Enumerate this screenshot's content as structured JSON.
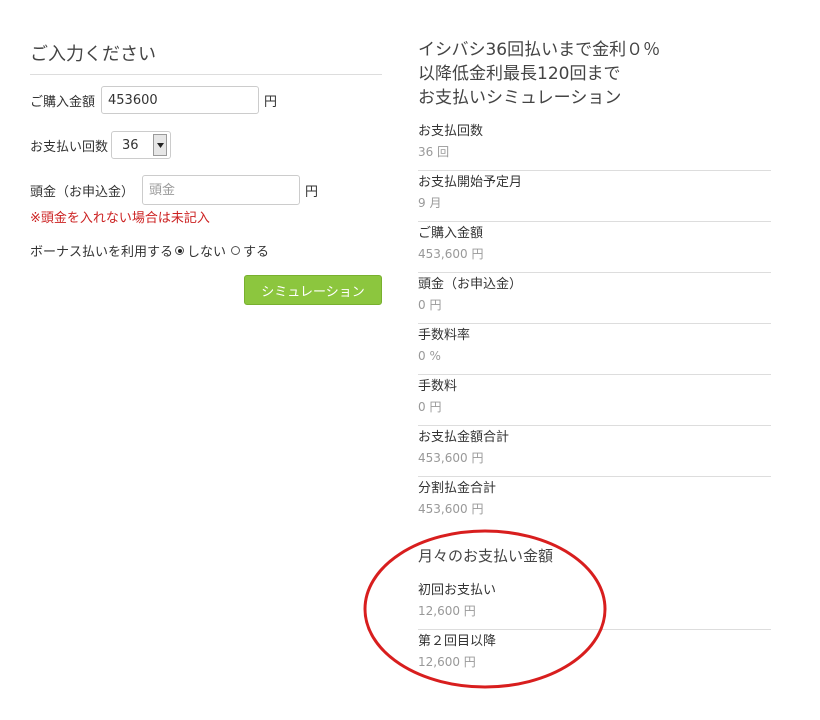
{
  "form": {
    "title": "ご入力ください",
    "amount_label": "ご購入金額",
    "amount_value": "453600",
    "yen": "円",
    "count_label": "お支払い回数",
    "count_value": "36",
    "down_label": "頭金（お申込金）",
    "down_placeholder": "頭金",
    "down_note": "※頭金を入れない場合は未記入",
    "bonus_label": "ボーナス払いを利用する",
    "bonus_no": "しない",
    "bonus_yes": "する",
    "bonus_selected": "しない",
    "button_label": "シミュレーション"
  },
  "result": {
    "title_lines": [
      "イシバシ36回払いまで金利０％",
      "以降低金利最長120回まで",
      "お支払いシミュレーション"
    ],
    "items": [
      {
        "label": "お支払回数",
        "value": "36 回"
      },
      {
        "label": "お支払開始予定月",
        "value": "9 月"
      },
      {
        "label": "ご購入金額",
        "value": "453,600 円"
      },
      {
        "label": "頭金（お申込金）",
        "value": "0 円"
      },
      {
        "label": "手数料率",
        "value": "0 %"
      },
      {
        "label": "手数料",
        "value": "0 円"
      },
      {
        "label": "お支払金額合計",
        "value": "453,600 円"
      },
      {
        "label": "分割払金合計",
        "value": "453,600 円"
      }
    ],
    "monthly_title": "月々のお支払い金額",
    "monthly": [
      {
        "label": "初回お支払い",
        "value": "12,600 円"
      },
      {
        "label": "第２回目以降",
        "value": "12,600 円"
      }
    ]
  },
  "colors": {
    "button_green": "#8cc63e",
    "warning_red": "#cc2222",
    "annotation_red": "#d81e1e"
  }
}
